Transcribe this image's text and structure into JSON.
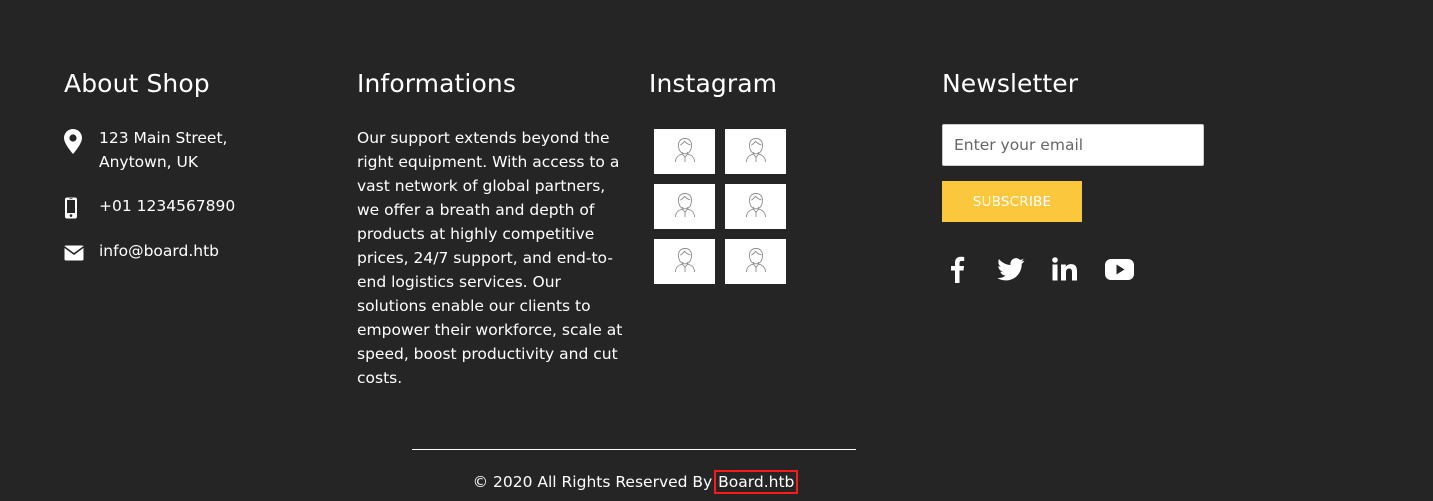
{
  "about": {
    "title": "About Shop",
    "address_line1": "123 Main Street,",
    "address_line2": "Anytown, UK",
    "phone": "+01 1234567890",
    "email": "info@board.htb",
    "address_icon": "map-pin-icon",
    "phone_icon": "mobile-phone-icon",
    "email_icon": "envelope-icon"
  },
  "informations": {
    "title": "Informations",
    "text": "Our support extends beyond the right equipment. With access to a vast network of global partners, we offer a breath and depth of products at highly competitive prices, 24/7 support, and end-to-end logistics services. Our solutions enable our clients to empower their workforce, scale at speed, boost productivity and cut costs."
  },
  "instagram": {
    "title": "Instagram",
    "images": [
      {
        "icon": "person-placeholder-icon"
      },
      {
        "icon": "person-placeholder-icon"
      },
      {
        "icon": "person-placeholder-icon"
      },
      {
        "icon": "person-placeholder-icon"
      },
      {
        "icon": "person-placeholder-icon"
      },
      {
        "icon": "person-placeholder-icon"
      }
    ]
  },
  "newsletter": {
    "title": "Newsletter",
    "email_placeholder": "Enter your email",
    "email_value": "",
    "subscribe_label": "SUBSCRIBE",
    "social": [
      {
        "icon": "facebook-icon"
      },
      {
        "icon": "twitter-icon"
      },
      {
        "icon": "linkedin-icon"
      },
      {
        "icon": "youtube-icon"
      }
    ]
  },
  "footer": {
    "copyright_prefix": "© 2020 All Rights Reserved By",
    "brand": "Board.htb"
  },
  "colors": {
    "background": "#252525",
    "accent": "#fbc73d",
    "text": "#ffffff",
    "highlight": "#ff1a1a"
  }
}
